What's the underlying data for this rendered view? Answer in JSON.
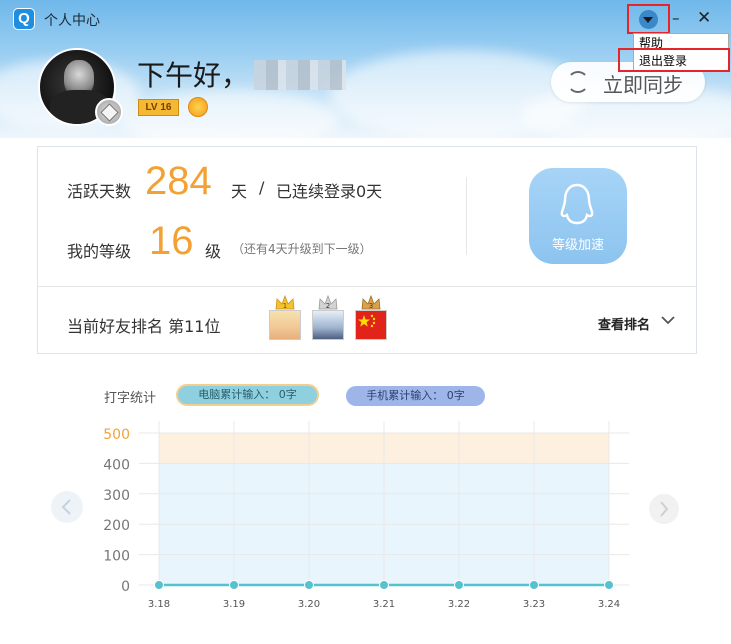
{
  "window": {
    "title": "个人中心",
    "logo_letter": "Q",
    "minimize_glyph": "–",
    "close_glyph": "✕"
  },
  "menu": {
    "items": [
      "帮助",
      "退出登录"
    ]
  },
  "profile": {
    "greeting": "下午好，",
    "level_badge": "LV 16"
  },
  "sync": {
    "label": "立即同步"
  },
  "stats": {
    "active_label": "活跃天数",
    "active_days": "284",
    "active_unit": "天",
    "separator": "/",
    "consecutive": "已连续登录0天",
    "level_label": "我的等级",
    "level": "16",
    "level_unit": "级",
    "level_note": "（还有4天升级到下一级）",
    "boost_label": "等级加速"
  },
  "rank": {
    "label": "当前好友排名 第11位",
    "view_label": "查看排名",
    "friends": [
      {
        "rank": "1",
        "crown_color": "#f2c230"
      },
      {
        "rank": "2",
        "crown_color": "#c7c7c7"
      },
      {
        "rank": "3",
        "crown_color": "#d19a45"
      }
    ]
  },
  "typing": {
    "title": "打字统计",
    "pc_label": "电脑累计输入： 0字",
    "mobile_label": "手机累计输入： 0字"
  },
  "chart_data": {
    "type": "line",
    "x": [
      "3.18",
      "3.19",
      "3.20",
      "3.21",
      "3.22",
      "3.23",
      "3.24"
    ],
    "series": [
      {
        "values": [
          0,
          0,
          0,
          0,
          0,
          0,
          0
        ]
      }
    ],
    "ylim": [
      0,
      500
    ],
    "yticks": [
      0,
      100,
      200,
      300,
      400,
      500
    ],
    "grid": true,
    "colors": {
      "line": "#56c1cf",
      "band_upper": "#fdf0df",
      "band_lower": "#e9f5fc",
      "tick_top": "#f2a33a",
      "tick": "#777777"
    }
  }
}
